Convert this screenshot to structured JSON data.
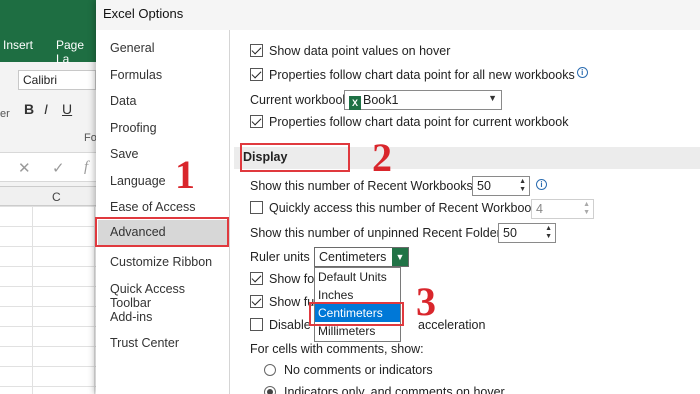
{
  "excel": {
    "tabs": [
      "Insert",
      "Page La"
    ],
    "font_name": "Calibri",
    "format_buttons": [
      "B",
      "I",
      "U"
    ],
    "ribbon_fragments": [
      "er",
      "Fo"
    ],
    "formula_icons": [
      "✕",
      "✓",
      "f"
    ],
    "column_letter": "C"
  },
  "dialog": {
    "title": "Excel Options",
    "nav_items": [
      "General",
      "Formulas",
      "Data",
      "Proofing",
      "Save",
      "Language",
      "Ease of Access",
      "Advanced",
      "Customize Ribbon",
      "Quick Access Toolbar",
      "Add-ins",
      "Trust Center"
    ],
    "active_nav": "Advanced",
    "options": {
      "show_values_hover": "Show data point values on hover",
      "follow_all": "Properties follow chart data point for all new workbooks",
      "current_workbook_label": "Current workbook:",
      "current_workbook_value": "Book1",
      "follow_current": "Properties follow chart data point for current workbook"
    },
    "display": {
      "section_title": "Display",
      "recent_workbooks_label": "Show this number of Recent Workbooks:",
      "recent_workbooks_value": "50",
      "quick_access_label": "Quickly access this number of Recent Workbooks:",
      "quick_access_value": "4",
      "unpinned_folders_label": "Show this number of unpinned Recent Folders:",
      "unpinned_folders_value": "50",
      "ruler_units_label": "Ruler units",
      "ruler_units_value": "Centimeters",
      "ruler_options": [
        "Default Units",
        "Inches",
        "Centimeters",
        "Millimeters"
      ],
      "show_for_fragment": "Show for",
      "show_fu_fragment": "Show fu",
      "disable_fragment": "Disable",
      "acceleration_fragment": "acceleration",
      "comments_label": "For cells with comments, show:",
      "radio_no_comments": "No comments or indicators",
      "radio_indicators": "Indicators only, and comments on hover"
    }
  },
  "annotations": [
    "1",
    "2",
    "3"
  ],
  "colors": {
    "excel_green": "#1e6e42",
    "selection_blue": "#0078d7",
    "annotation_red": "#d9262c"
  }
}
